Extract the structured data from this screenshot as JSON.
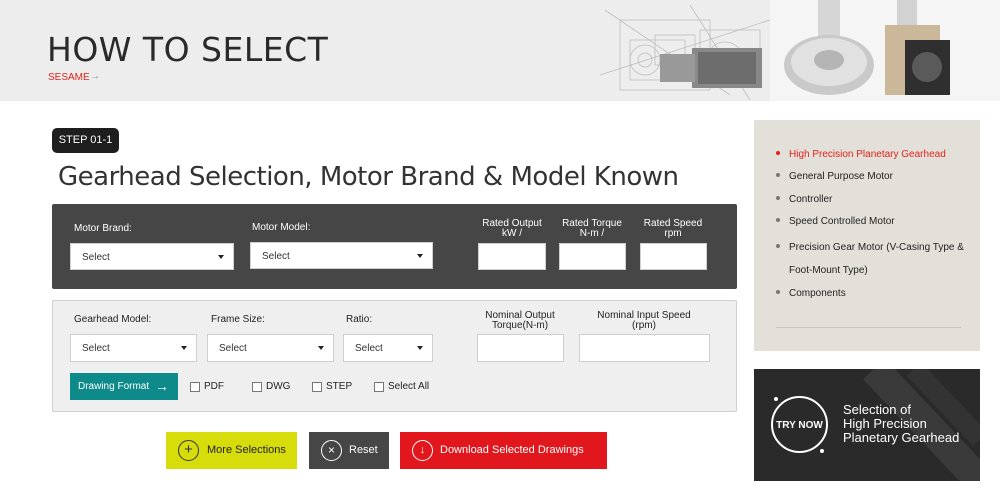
{
  "banner": {
    "title": "HOW TO SELECT",
    "breadcrumb": "SESAME",
    "breadcrumb_arrow": "→"
  },
  "step": {
    "badge": "STEP 01-1",
    "title": "Gearhead Selection, Motor Brand & Model Known"
  },
  "motor": {
    "brand_label": "Motor Brand:",
    "brand_value": "Select",
    "model_label": "Motor Model:",
    "model_value": "Select",
    "rated_output_label": "Rated Output\nkW /",
    "rated_torque_label": "Rated Torque\nN-m /",
    "rated_speed_label": "Rated Speed\nrpm"
  },
  "gearhead": {
    "model_label": "Gearhead Model:",
    "model_value": "Select",
    "frame_label": "Frame Size:",
    "frame_value": "Select",
    "ratio_label": "Ratio:",
    "ratio_value": "Select",
    "nominal_torque_label": "Nominal Output\nTorque(N-m)",
    "nominal_speed_label": "Nominal Input Speed\n(rpm)"
  },
  "drawing": {
    "format_label": "Drawing Format",
    "options": [
      "PDF",
      "DWG",
      "STEP",
      "Select All"
    ]
  },
  "actions": {
    "more": "More Selections",
    "reset": "Reset",
    "download": "Download Selected Drawings"
  },
  "categories": [
    {
      "label": "High Precision Planetary Gearhead",
      "active": true
    },
    {
      "label": "General Purpose Motor",
      "active": false
    },
    {
      "label": "Controller",
      "active": false
    },
    {
      "label": "Speed Controlled Motor",
      "active": false
    },
    {
      "label": "Precision Gear Motor (V-Casing Type &",
      "active": false
    },
    {
      "label": "Foot-Mount Type)",
      "active": false
    },
    {
      "label": "Components",
      "active": false
    }
  ],
  "promo": {
    "badge": "TRY NOW",
    "line1": "Selection of",
    "line2": "High Precision",
    "line3": "Planetary Gearhead"
  },
  "colors": {
    "accent_red": "#e2231a",
    "teal": "#0f8a8a",
    "lime": "#d7dc0b",
    "dark_panel": "#464646"
  }
}
